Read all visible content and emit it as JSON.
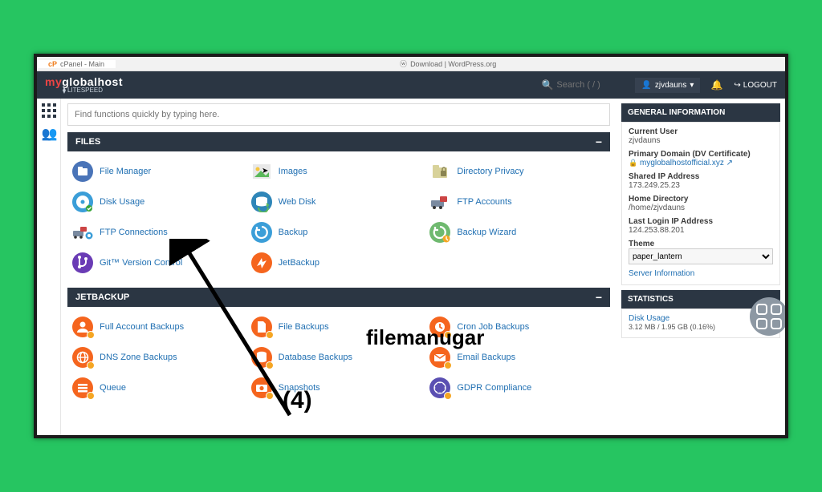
{
  "browser": {
    "tab1": "cPanel - Main",
    "tab2": "Download | WordPress.org"
  },
  "header": {
    "logo_my": "my",
    "logo_rest": "globalhost",
    "logo_sub": "LITESPEED",
    "search_placeholder": "Search ( / )",
    "user": "zjvdauns",
    "logout": "LOGOUT"
  },
  "searchbar": {
    "placeholder": "Find functions quickly by typing here."
  },
  "files": {
    "title": "FILES",
    "items": [
      {
        "label": "File Manager",
        "color": "#4a74b8",
        "icon": "file-manager"
      },
      {
        "label": "Images",
        "color": "#5bb85b",
        "icon": "images"
      },
      {
        "label": "Directory Privacy",
        "color": "#c8c8a8",
        "icon": "dir-priv"
      },
      {
        "label": "Disk Usage",
        "color": "#3b9ed8",
        "icon": "disk-usage"
      },
      {
        "label": "Web Disk",
        "color": "#2f86b8",
        "icon": "web-disk"
      },
      {
        "label": "FTP Accounts",
        "color": "#7a8aa0",
        "icon": "ftp-accounts"
      },
      {
        "label": "FTP Connections",
        "color": "#7a8aa0",
        "icon": "ftp-conn"
      },
      {
        "label": "Backup",
        "color": "#3b9ed8",
        "icon": "backup"
      },
      {
        "label": "Backup Wizard",
        "color": "#6fb96f",
        "icon": "backup-wiz"
      },
      {
        "label": "Git™ Version Control",
        "color": "#6a3cb5",
        "icon": "git"
      },
      {
        "label": "JetBackup",
        "color": "#f5651e",
        "icon": "jetbackup"
      }
    ]
  },
  "jetbackup": {
    "title": "JETBACKUP",
    "items": [
      {
        "label": "Full Account Backups",
        "color": "#f5651e",
        "icon": "full-backups"
      },
      {
        "label": "File Backups",
        "color": "#f5651e",
        "icon": "file-backups"
      },
      {
        "label": "Cron Job Backups",
        "color": "#f5651e",
        "icon": "cron-backups"
      },
      {
        "label": "DNS Zone Backups",
        "color": "#f5651e",
        "icon": "dns-backups"
      },
      {
        "label": "Database Backups",
        "color": "#f5651e",
        "icon": "db-backups"
      },
      {
        "label": "Email Backups",
        "color": "#f5651e",
        "icon": "email-backups"
      },
      {
        "label": "Queue",
        "color": "#f5651e",
        "icon": "queue"
      },
      {
        "label": "Snapshots",
        "color": "#f5651e",
        "icon": "snapshots"
      },
      {
        "label": "GDPR Compliance",
        "color": "#5a4fb2",
        "icon": "gdpr"
      }
    ]
  },
  "geninfo": {
    "title": "GENERAL INFORMATION",
    "current_user_k": "Current User",
    "current_user_v": "zjvdauns",
    "primary_domain_k": "Primary Domain (DV Certificate)",
    "primary_domain_v": "myglobalhostofficial.xyz",
    "shared_ip_k": "Shared IP Address",
    "shared_ip_v": "173.249.25.23",
    "home_dir_k": "Home Directory",
    "home_dir_v": "/home/zjvdauns",
    "last_login_k": "Last Login IP Address",
    "last_login_v": "124.253.88.201",
    "theme_k": "Theme",
    "theme_v": "paper_lantern",
    "server_info": "Server Information"
  },
  "stats": {
    "title": "STATISTICS",
    "disk_usage_k": "Disk Usage",
    "disk_usage_v": "3.12 MB / 1.95 GB   (0.16%)"
  },
  "annot": {
    "t1": "filemanugar",
    "t2": "(4)"
  }
}
